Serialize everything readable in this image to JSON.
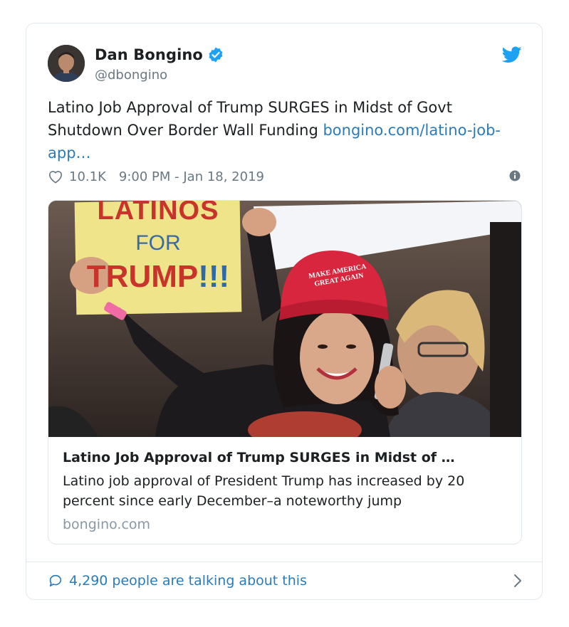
{
  "author": {
    "name": "Dan Bongino",
    "handle": "@dbongino",
    "verified": true
  },
  "tweet": {
    "text": "Latino Job Approval of Trump SURGES in Midst of Govt Shutdown Over Border Wall Funding ",
    "link_text": "bongino.com/latino-job-app…",
    "likes": "10.1K",
    "timestamp": "9:00 PM - Jan 18, 2019"
  },
  "card": {
    "image_sign": {
      "line1": "LATINOS",
      "line2": "FOR",
      "line3": "TRUMP",
      "line3_suffix": "!!!"
    },
    "hat_text": {
      "line1": "MAKE AMERICA",
      "line2": "GREAT AGAIN"
    },
    "title": "Latino Job Approval of Trump SURGES in Midst of …",
    "description": "Latino job approval of President Trump has increased by 20 percent since early December–a noteworthy jump",
    "domain": "bongino.com"
  },
  "footer": {
    "conversation_label": "4,290 people are talking about this"
  },
  "colors": {
    "accent": "#1da1f2",
    "link": "#2b7bb9",
    "muted": "#697882",
    "border": "#e1e8ed",
    "hat_red": "#d7263d",
    "sign_yellow": "#efe48a"
  },
  "icons": {
    "verified": "verified-badge-icon",
    "brand": "twitter-bird-icon",
    "like": "heart-icon",
    "info": "info-icon",
    "reply": "speech-bubble-icon",
    "more": "chevron-right-icon"
  }
}
